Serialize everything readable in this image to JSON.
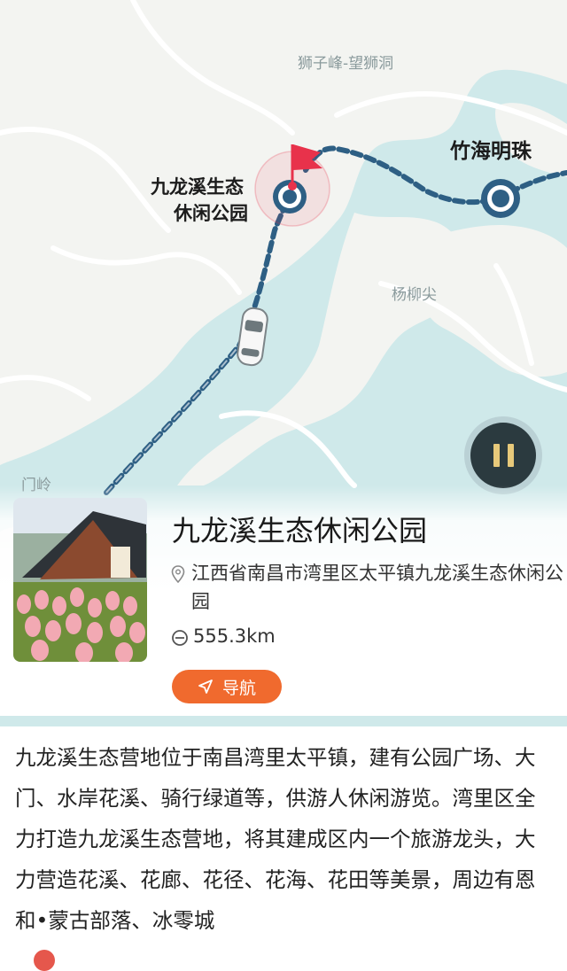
{
  "map": {
    "labels": {
      "peak": "狮子峰-望狮洞",
      "bamboo_pearl": "竹海明珠",
      "yangliu": "杨柳尖",
      "menling": "门岭",
      "start_line1": "九龙溪生态",
      "start_line2": "休闲公园"
    },
    "controls": {
      "pause_icon": "pause-icon"
    },
    "colors": {
      "route": "#2e5f84",
      "flag": "#e8324b",
      "water": "#cfe9ea"
    }
  },
  "place": {
    "title": "九龙溪生态休闲公园",
    "address": "江西省南昌市湾里区太平镇九龙溪生态休闲公园",
    "distance": "555.3km",
    "nav_label": "导航",
    "description": "九龙溪生态营地位于南昌湾里太平镇，建有公园广场、大门、水岸花溪、骑行绿道等，供游人休闲游览。湾里区全力打造九龙溪生态营地，将其建成区内一个旅游龙头，大力营造花溪、花廊、花径、花海、花田等美景，周边有恩和•蒙古部落、冰零城"
  },
  "colors": {
    "accent": "#f06a2e"
  }
}
